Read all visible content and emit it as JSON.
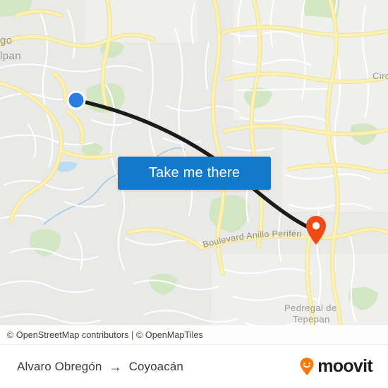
{
  "map": {
    "attribution": "© OpenStreetMap contributors | © OpenMapTiles",
    "labels": {
      "top_left_1": "go",
      "top_left_2": "lpan",
      "right_edge": "Circ",
      "road_periferico": "Boulevard Anillo Periférico",
      "area_pedregal_1": "Pedregal de",
      "area_pedregal_2": "Tepepan"
    },
    "origin_marker": "origin-dot",
    "destination_marker": "destination-pin",
    "colors": {
      "land": "#e9e9e7",
      "park": "#d3e6c4",
      "water": "#9fc9e8",
      "road_major": "#f9e9a0",
      "road_minor": "#ffffff",
      "route_line": "#1b1b1b",
      "origin": "#2a7de1",
      "destination": "#f04b16"
    }
  },
  "cta": {
    "label": "Take me there"
  },
  "footer": {
    "origin": "Alvaro Obregón",
    "arrow": "→",
    "destination": "Coyoacán",
    "brand": "moovit",
    "brand_color": "#ff7800"
  }
}
